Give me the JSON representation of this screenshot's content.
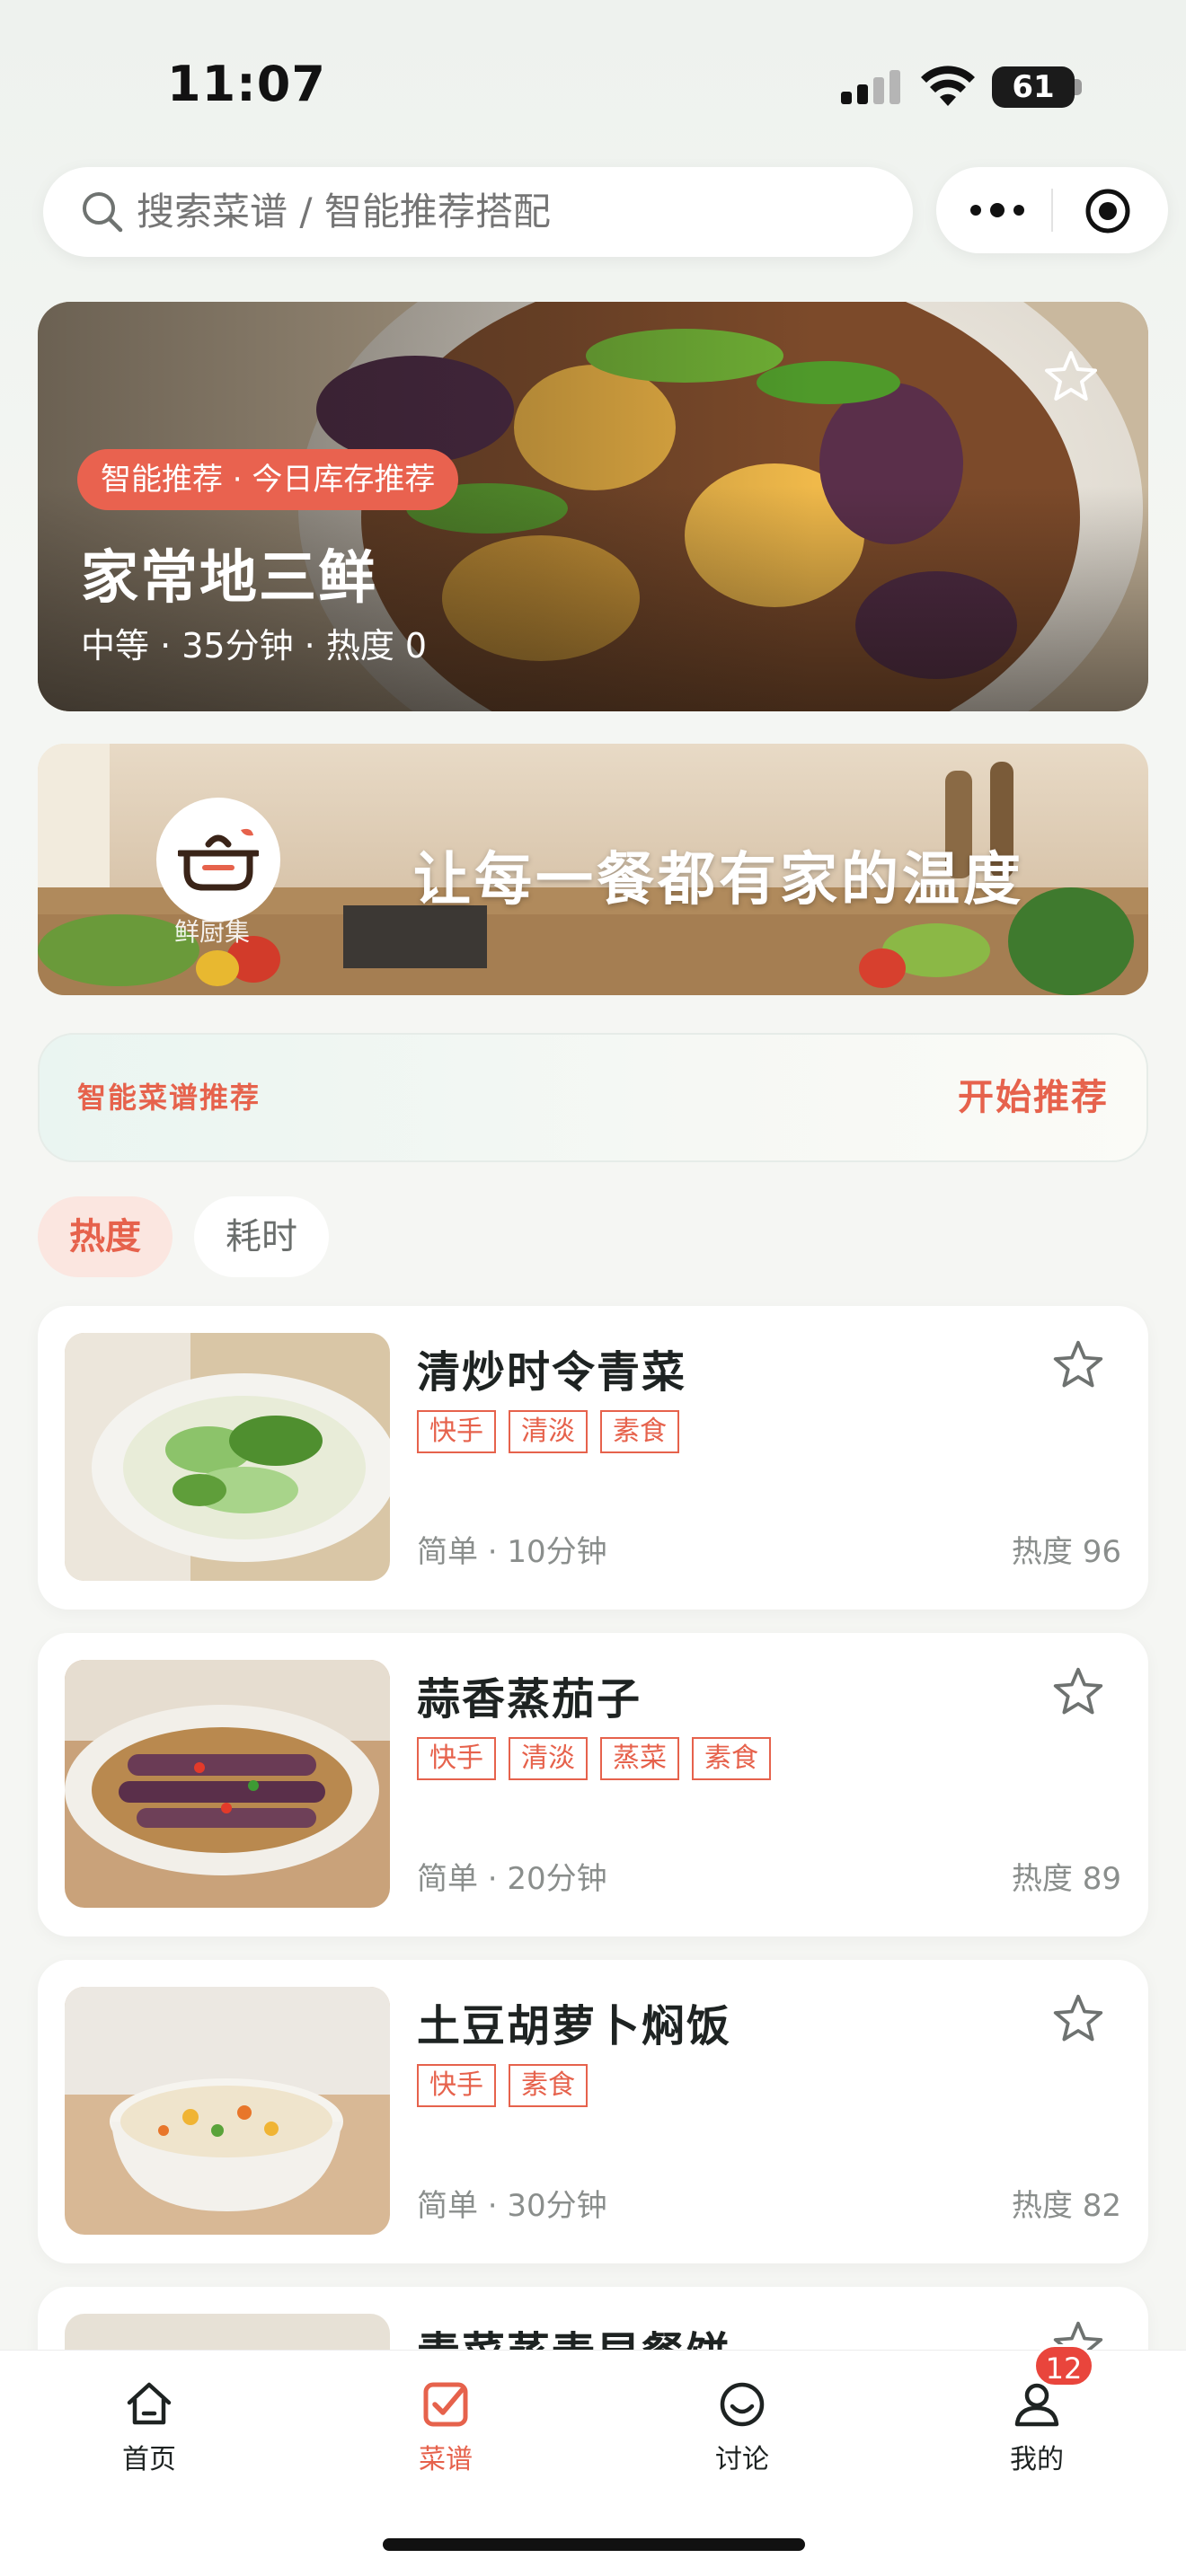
{
  "status_bar": {
    "time": "11:07",
    "battery": "61"
  },
  "search": {
    "placeholder": "搜索菜谱 / 智能推荐搭配"
  },
  "hero": {
    "badge": "智能推荐 · 今日库存推荐",
    "title": "家常地三鲜",
    "meta": "中等 · 35分钟 · 热度 0"
  },
  "banner": {
    "brand": "鲜厨集",
    "slogan": "让每一餐都有家的温度"
  },
  "recommend": {
    "title": "智能菜谱推荐",
    "button": "开始推荐"
  },
  "sort": {
    "hot": "热度",
    "time": "耗时"
  },
  "recipes": [
    {
      "title": "清炒时令青菜",
      "tags": [
        "快手",
        "清淡",
        "素食"
      ],
      "meta": "简单 · 10分钟",
      "heat": "热度 96"
    },
    {
      "title": "蒜香蒸茄子",
      "tags": [
        "快手",
        "清淡",
        "蒸菜",
        "素食"
      ],
      "meta": "简单 · 20分钟",
      "heat": "热度 89"
    },
    {
      "title": "土豆胡萝卜焖饭",
      "tags": [
        "快手",
        "素食"
      ],
      "meta": "简单 · 30分钟",
      "heat": "热度 82"
    },
    {
      "title": "青菜蒸麦早餐饼",
      "tags": [],
      "meta": "",
      "heat": ""
    }
  ],
  "tabbar": {
    "items": [
      {
        "label": "首页",
        "icon": "home-icon"
      },
      {
        "label": "菜谱",
        "icon": "recipe-check-icon"
      },
      {
        "label": "讨论",
        "icon": "smile-chat-icon"
      },
      {
        "label": "我的",
        "icon": "user-icon"
      }
    ],
    "active": 1,
    "badge": "12"
  },
  "colors": {
    "accent": "#e6624c",
    "badge": "#e9453c"
  }
}
